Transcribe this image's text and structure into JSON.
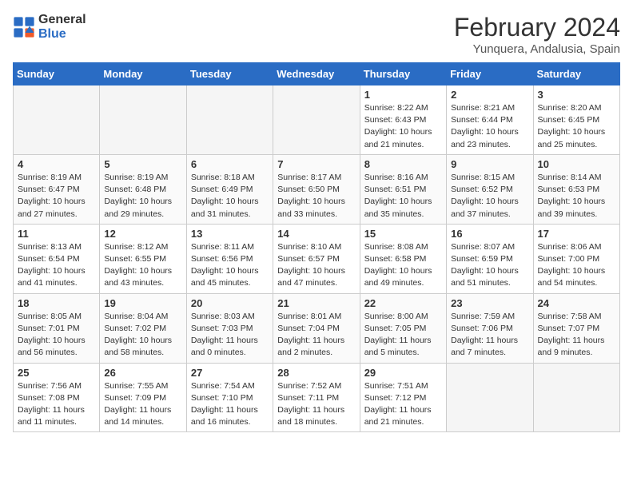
{
  "logo": {
    "line1": "General",
    "line2": "Blue"
  },
  "title": "February 2024",
  "location": "Yunquera, Andalusia, Spain",
  "headers": [
    "Sunday",
    "Monday",
    "Tuesday",
    "Wednesday",
    "Thursday",
    "Friday",
    "Saturday"
  ],
  "weeks": [
    [
      {
        "day": "",
        "info": ""
      },
      {
        "day": "",
        "info": ""
      },
      {
        "day": "",
        "info": ""
      },
      {
        "day": "",
        "info": ""
      },
      {
        "day": "1",
        "info": "Sunrise: 8:22 AM\nSunset: 6:43 PM\nDaylight: 10 hours\nand 21 minutes."
      },
      {
        "day": "2",
        "info": "Sunrise: 8:21 AM\nSunset: 6:44 PM\nDaylight: 10 hours\nand 23 minutes."
      },
      {
        "day": "3",
        "info": "Sunrise: 8:20 AM\nSunset: 6:45 PM\nDaylight: 10 hours\nand 25 minutes."
      }
    ],
    [
      {
        "day": "4",
        "info": "Sunrise: 8:19 AM\nSunset: 6:47 PM\nDaylight: 10 hours\nand 27 minutes."
      },
      {
        "day": "5",
        "info": "Sunrise: 8:19 AM\nSunset: 6:48 PM\nDaylight: 10 hours\nand 29 minutes."
      },
      {
        "day": "6",
        "info": "Sunrise: 8:18 AM\nSunset: 6:49 PM\nDaylight: 10 hours\nand 31 minutes."
      },
      {
        "day": "7",
        "info": "Sunrise: 8:17 AM\nSunset: 6:50 PM\nDaylight: 10 hours\nand 33 minutes."
      },
      {
        "day": "8",
        "info": "Sunrise: 8:16 AM\nSunset: 6:51 PM\nDaylight: 10 hours\nand 35 minutes."
      },
      {
        "day": "9",
        "info": "Sunrise: 8:15 AM\nSunset: 6:52 PM\nDaylight: 10 hours\nand 37 minutes."
      },
      {
        "day": "10",
        "info": "Sunrise: 8:14 AM\nSunset: 6:53 PM\nDaylight: 10 hours\nand 39 minutes."
      }
    ],
    [
      {
        "day": "11",
        "info": "Sunrise: 8:13 AM\nSunset: 6:54 PM\nDaylight: 10 hours\nand 41 minutes."
      },
      {
        "day": "12",
        "info": "Sunrise: 8:12 AM\nSunset: 6:55 PM\nDaylight: 10 hours\nand 43 minutes."
      },
      {
        "day": "13",
        "info": "Sunrise: 8:11 AM\nSunset: 6:56 PM\nDaylight: 10 hours\nand 45 minutes."
      },
      {
        "day": "14",
        "info": "Sunrise: 8:10 AM\nSunset: 6:57 PM\nDaylight: 10 hours\nand 47 minutes."
      },
      {
        "day": "15",
        "info": "Sunrise: 8:08 AM\nSunset: 6:58 PM\nDaylight: 10 hours\nand 49 minutes."
      },
      {
        "day": "16",
        "info": "Sunrise: 8:07 AM\nSunset: 6:59 PM\nDaylight: 10 hours\nand 51 minutes."
      },
      {
        "day": "17",
        "info": "Sunrise: 8:06 AM\nSunset: 7:00 PM\nDaylight: 10 hours\nand 54 minutes."
      }
    ],
    [
      {
        "day": "18",
        "info": "Sunrise: 8:05 AM\nSunset: 7:01 PM\nDaylight: 10 hours\nand 56 minutes."
      },
      {
        "day": "19",
        "info": "Sunrise: 8:04 AM\nSunset: 7:02 PM\nDaylight: 10 hours\nand 58 minutes."
      },
      {
        "day": "20",
        "info": "Sunrise: 8:03 AM\nSunset: 7:03 PM\nDaylight: 11 hours\nand 0 minutes."
      },
      {
        "day": "21",
        "info": "Sunrise: 8:01 AM\nSunset: 7:04 PM\nDaylight: 11 hours\nand 2 minutes."
      },
      {
        "day": "22",
        "info": "Sunrise: 8:00 AM\nSunset: 7:05 PM\nDaylight: 11 hours\nand 5 minutes."
      },
      {
        "day": "23",
        "info": "Sunrise: 7:59 AM\nSunset: 7:06 PM\nDaylight: 11 hours\nand 7 minutes."
      },
      {
        "day": "24",
        "info": "Sunrise: 7:58 AM\nSunset: 7:07 PM\nDaylight: 11 hours\nand 9 minutes."
      }
    ],
    [
      {
        "day": "25",
        "info": "Sunrise: 7:56 AM\nSunset: 7:08 PM\nDaylight: 11 hours\nand 11 minutes."
      },
      {
        "day": "26",
        "info": "Sunrise: 7:55 AM\nSunset: 7:09 PM\nDaylight: 11 hours\nand 14 minutes."
      },
      {
        "day": "27",
        "info": "Sunrise: 7:54 AM\nSunset: 7:10 PM\nDaylight: 11 hours\nand 16 minutes."
      },
      {
        "day": "28",
        "info": "Sunrise: 7:52 AM\nSunset: 7:11 PM\nDaylight: 11 hours\nand 18 minutes."
      },
      {
        "day": "29",
        "info": "Sunrise: 7:51 AM\nSunset: 7:12 PM\nDaylight: 11 hours\nand 21 minutes."
      },
      {
        "day": "",
        "info": ""
      },
      {
        "day": "",
        "info": ""
      }
    ]
  ]
}
